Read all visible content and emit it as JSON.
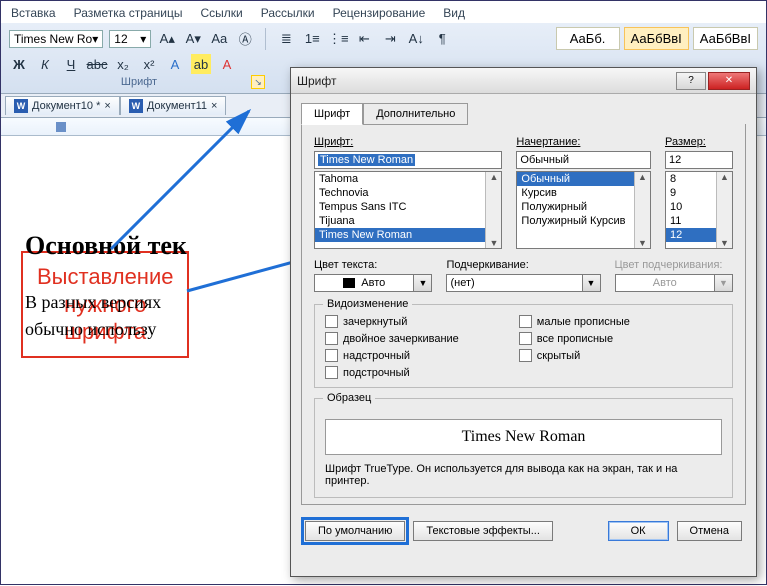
{
  "ribbon": {
    "tabs": [
      "Вставка",
      "Разметка страницы",
      "Ссылки",
      "Рассылки",
      "Рецензирование",
      "Вид"
    ],
    "font_name": "Times New Ro",
    "font_size": "12",
    "group_label": "Шрифт",
    "styles": [
      "АаБб.",
      "АаБбВвІ",
      "АаБбВвІ"
    ]
  },
  "doc_tabs": [
    {
      "label": "Документ10 *"
    },
    {
      "label": "Документ11"
    }
  ],
  "callout": {
    "l1": "Выставление",
    "l2": "нужного",
    "l3": "шрифта"
  },
  "page": {
    "heading": "Основной тек",
    "p1": "В разных версиях",
    "p2": "обычно использу"
  },
  "dialog": {
    "title": "Шрифт",
    "tabs": {
      "font": "Шрифт",
      "adv": "Дополнительно"
    },
    "font_label": "Шрифт:",
    "font_value": "Times New Roman",
    "font_list": [
      "Tahoma",
      "Technovia",
      "Tempus Sans ITC",
      "Tijuana",
      "Times New Roman"
    ],
    "style_label": "Начертание:",
    "style_value": "Обычный",
    "style_list": [
      "Обычный",
      "Курсив",
      "Полужирный",
      "Полужирный Курсив"
    ],
    "size_label": "Размер:",
    "size_value": "12",
    "size_list": [
      "8",
      "9",
      "10",
      "11",
      "12"
    ],
    "color_label": "Цвет текста:",
    "color_value": "Авто",
    "under_label": "Подчеркивание:",
    "under_value": "(нет)",
    "ucolor_label": "Цвет подчеркивания:",
    "ucolor_value": "Авто",
    "effects_legend": "Видоизменение",
    "effects_left": [
      "зачеркнутый",
      "двойное зачеркивание",
      "надстрочный",
      "подстрочный"
    ],
    "effects_right": [
      "малые прописные",
      "все прописные",
      "скрытый"
    ],
    "sample_legend": "Образец",
    "sample_text": "Times New Roman",
    "hint": "Шрифт TrueType. Он используется для вывода как на экран, так и на принтер.",
    "btn_default": "По умолчанию",
    "btn_effects": "Текстовые эффекты...",
    "btn_ok": "ОК",
    "btn_cancel": "Отмена"
  }
}
